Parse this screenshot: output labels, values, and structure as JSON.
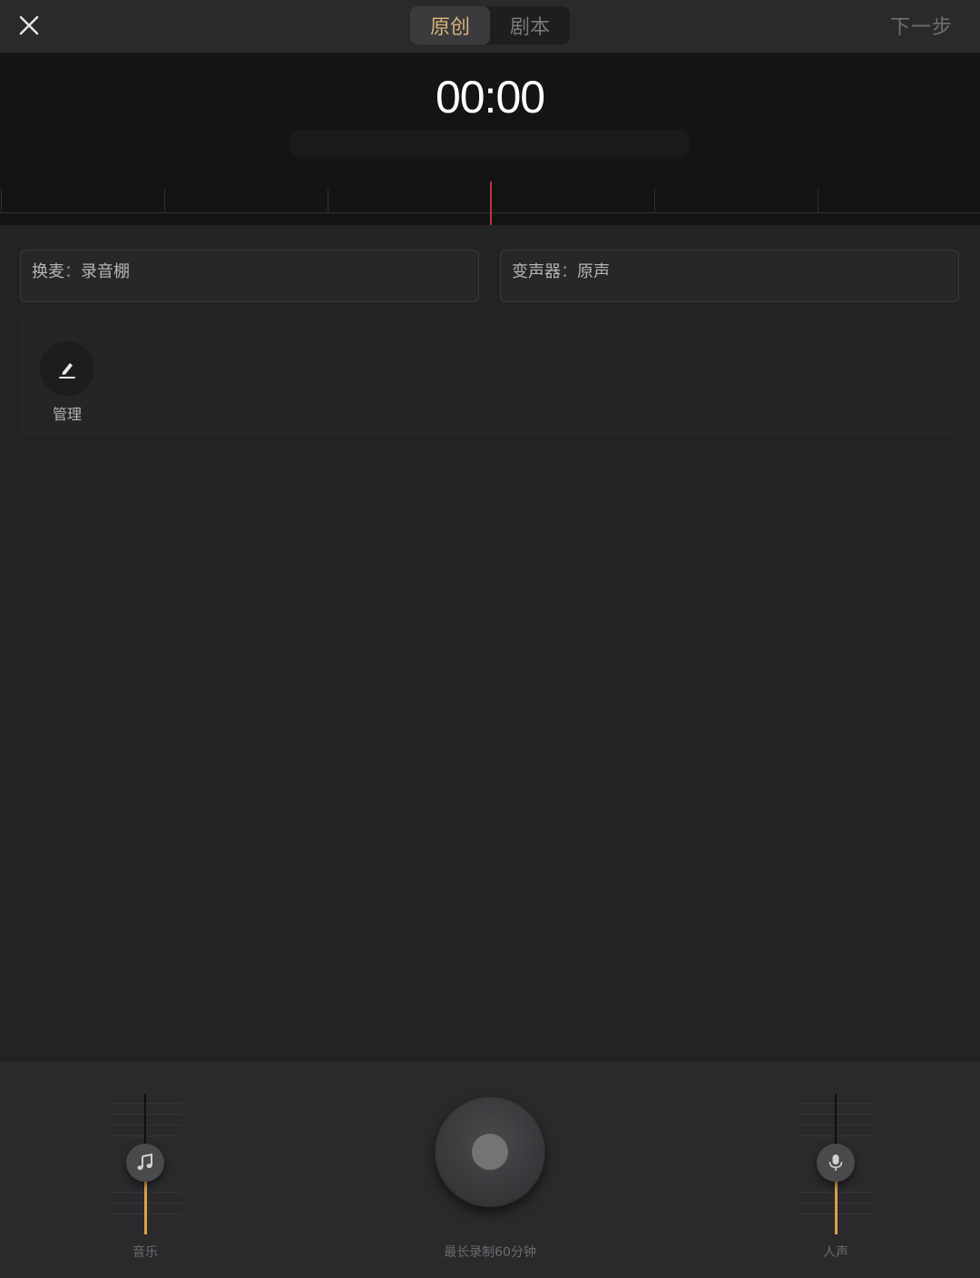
{
  "header": {
    "tabs": [
      {
        "label": "原创",
        "active": true
      },
      {
        "label": "剧本",
        "active": false
      }
    ],
    "next_label": "下一步"
  },
  "timer": {
    "time": "00:00"
  },
  "options": {
    "mic": {
      "label": "换麦",
      "sep": "：",
      "value": "录音棚"
    },
    "voice_changer": {
      "label": "变声器",
      "sep": "：",
      "value": "原声"
    }
  },
  "manage": {
    "label": "管理"
  },
  "controls": {
    "music_label": "音乐",
    "voice_label": "人声",
    "record_hint": "最长录制60分钟"
  },
  "colors": {
    "accent": "#d6b377",
    "slider_fill": "#d9a24a",
    "playhead": "#c2343b",
    "background": "#232225"
  }
}
